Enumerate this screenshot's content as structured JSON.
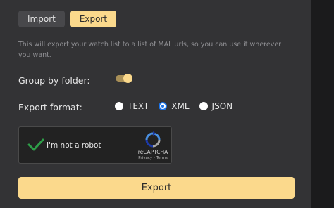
{
  "tabs": {
    "import_label": "Import",
    "export_label": "Export",
    "active": "Export"
  },
  "description": "This will export your watch list to a list of MAL urls, so you can use it wherever you want.",
  "group_by_folder": {
    "label": "Group by folder:",
    "enabled": true
  },
  "export_format": {
    "label": "Export format:",
    "options": [
      "TEXT",
      "XML",
      "JSON"
    ],
    "selected": "XML"
  },
  "recaptcha": {
    "checkbox_label": "I'm not a robot",
    "checked": true,
    "brand": "reCAPTCHA",
    "privacy": "Privacy",
    "separator": "-",
    "terms": "Terms"
  },
  "export_button_label": "Export",
  "colors": {
    "accent": "#fbd98c",
    "panel": "#333335",
    "radio_selected": "#1a73e8",
    "checkmark": "#2e9e48"
  }
}
